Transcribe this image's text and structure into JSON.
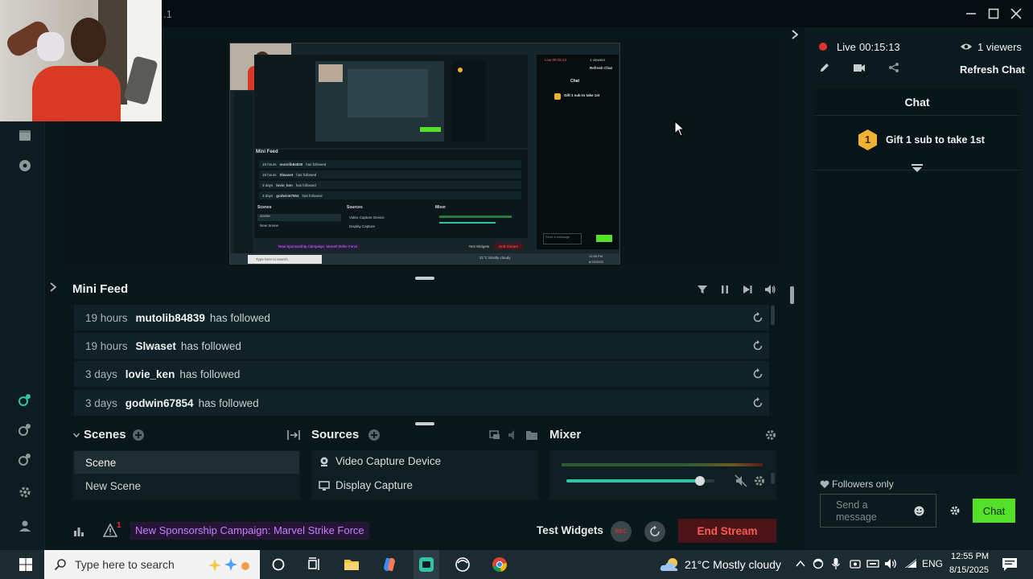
{
  "titlebar": {
    "version_fragment": ".1"
  },
  "live": {
    "label": "Live",
    "duration": "00:15:13",
    "viewers": "1 viewers"
  },
  "chat": {
    "refresh_label": "Refresh Chat",
    "title": "Chat",
    "gift_rank": "1",
    "gift_text": "Gift 1 sub to take 1st",
    "followers_only": "Followers only",
    "placeholder_line1": "Send a",
    "placeholder_line2": "message",
    "send_label": "Chat"
  },
  "minifeed": {
    "title": "Mini Feed",
    "rows": [
      {
        "time": "19 hours",
        "user": "mutolib84839",
        "action": "has followed"
      },
      {
        "time": "19 hours",
        "user": "Slwaset",
        "action": "has followed"
      },
      {
        "time": "3 days",
        "user": "lovie_ken",
        "action": "has followed"
      },
      {
        "time": "3 days",
        "user": "godwin67854",
        "action": "has followed"
      }
    ]
  },
  "scenes": {
    "title": "Scenes",
    "items": [
      "Scene",
      "New Scene"
    ]
  },
  "sources": {
    "title": "Sources",
    "items": [
      "Video Capture Device",
      "Display Capture"
    ]
  },
  "mixer": {
    "title": "Mixer",
    "volume": 0.9
  },
  "footer": {
    "alert_count": "1",
    "sponsor_text": "New Sponsorship Campaign: Marvel Strike Force",
    "test_widgets": "Test Widgets",
    "rec_label": "REC",
    "end_stream": "End Stream"
  },
  "preview_mini": {
    "minifeed": "Mini Feed",
    "rows": [
      {
        "time": "19 hours",
        "user": "mutolib84839",
        "action": "has followed"
      },
      {
        "time": "19 hours",
        "user": "Slwaset",
        "action": "has followed"
      },
      {
        "time": "3 days",
        "user": "lovie_ken",
        "action": "has followed"
      },
      {
        "time": "3 days",
        "user": "godwin67854",
        "action": "has followed"
      }
    ],
    "scenes": "Scenes",
    "sources": "Sources",
    "mixer": "Mixer",
    "scene1": "Scene",
    "scene2": "New Scene",
    "src1": "Video Capture Device",
    "src2": "Display Capture",
    "chat": "Chat",
    "gift": "Gift 1 sub to take 1st",
    "test_widgets": "Test Widgets",
    "end_stream": "End Stream",
    "sponsor": "New Sponsorship Campaign: Marvel Strike Force",
    "search": "Type here to search",
    "live": "Live 00:15:13",
    "viewers": "1 viewers",
    "refresh": "Refresh Chat",
    "send": "Send a message",
    "weather": "21°C Mostly cloudy",
    "time": "12:55 PM",
    "date": "8/15/2025"
  },
  "taskbar": {
    "search_placeholder": "Type here to search",
    "weather": "21°C Mostly cloudy",
    "lang": "ENG",
    "time": "12:55 PM",
    "date": "8/15/2025"
  },
  "colors": {
    "accent_green": "#31c3a2",
    "chat_button": "#54e02a",
    "live_red": "#e0322f",
    "end_stream_bg": "#4a1418",
    "end_stream_text": "#ff5a4e",
    "sponsor_text": "#c77dff",
    "gift_badge": "#f0b232"
  }
}
